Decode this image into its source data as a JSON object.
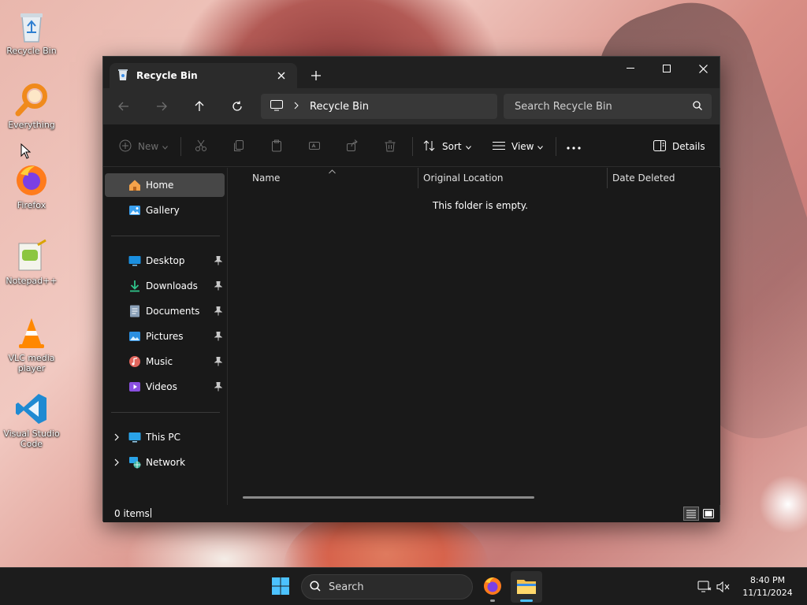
{
  "desktop": {
    "icons": [
      {
        "label": "Recycle Bin"
      },
      {
        "label": "Everything"
      },
      {
        "label": "Firefox"
      },
      {
        "label": "Notepad++"
      },
      {
        "label": "VLC media player"
      },
      {
        "label": "Visual Studio Code"
      }
    ]
  },
  "window": {
    "tab_title": "Recycle Bin",
    "address": {
      "location": "Recycle Bin"
    },
    "search": {
      "placeholder": "Search Recycle Bin"
    },
    "toolbar": {
      "new_label": "New",
      "sort_label": "Sort",
      "view_label": "View",
      "details_label": "Details"
    },
    "sidebar": {
      "home": "Home",
      "gallery": "Gallery",
      "quick_access": [
        {
          "label": "Desktop"
        },
        {
          "label": "Downloads"
        },
        {
          "label": "Documents"
        },
        {
          "label": "Pictures"
        },
        {
          "label": "Music"
        },
        {
          "label": "Videos"
        }
      ],
      "this_pc": "This PC",
      "network": "Network"
    },
    "columns": {
      "name": "Name",
      "original_location": "Original Location",
      "date_deleted": "Date Deleted"
    },
    "empty_message": "This folder is empty.",
    "status": {
      "items": "0 items"
    }
  },
  "taskbar": {
    "search_label": "Search",
    "clock": {
      "time": "8:40 PM",
      "date": "11/11/2024"
    }
  },
  "colors": {
    "window_bg": "#191919",
    "nav_bg": "#2b2b2b",
    "accent": "#4cc2ff",
    "folder_yellow": "#f2c14e"
  },
  "icons": {
    "sidebar": [
      "home-icon",
      "gallery-icon",
      "desktop-icon",
      "downloads-icon",
      "documents-icon",
      "pictures-icon",
      "music-icon",
      "videos-icon",
      "this-pc-icon",
      "network-icon"
    ]
  }
}
